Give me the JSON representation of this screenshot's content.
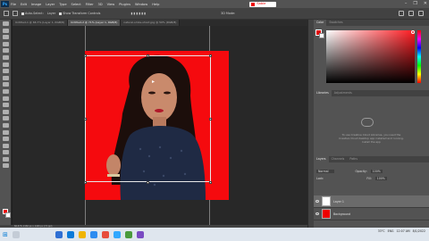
{
  "app": {
    "logo": "Ps",
    "menu": [
      "File",
      "Edit",
      "Image",
      "Layer",
      "Type",
      "Select",
      "Filter",
      "3D",
      "View",
      "Plugins",
      "Window",
      "Help"
    ],
    "search_value": "Sabie",
    "window_controls": [
      "–",
      "❐",
      "✕"
    ]
  },
  "options_bar": {
    "auto_select_label": "Auto-Select:",
    "auto_select_value": "Layer",
    "show_transform": "Show Transform Controls",
    "mode_3d": "3D Mode:"
  },
  "document_tabs": [
    {
      "label": "Untitled-1 @ 66.7% (Layer 1, RGB/8)",
      "active": false
    },
    {
      "label": "Untitled-2 @ 71% (Layer 1, RGB/8)",
      "active": true
    },
    {
      "label": "natural-smile-shoot.jpg @ 50% (RGB/8)",
      "active": false
    }
  ],
  "status_bar": "66.67%   2160 px x 1440 px (72 ppi)",
  "color_panel": {
    "tabs": [
      "Color",
      "Swatches"
    ],
    "foreground": "#e00000",
    "background": "#ffffff"
  },
  "libraries_panel": {
    "tabs": [
      "Libraries",
      "Adjustments"
    ],
    "message": "To use Creative Cloud Libraries, you need the Creative Cloud desktop app installed and running. Install the app"
  },
  "layers_panel": {
    "tabs": [
      "Layers",
      "Channels",
      "Paths"
    ],
    "blend_mode": "Normal",
    "opacity_label": "Opacity:",
    "opacity_value": "100%",
    "fill_label": "Fill:",
    "fill_value": "100%",
    "lock_label": "Lock:",
    "layers": [
      {
        "name": "Layer 1",
        "selected": true
      },
      {
        "name": "Background",
        "selected": false
      }
    ]
  },
  "taskbar": {
    "search_placeholder": "Type here to search",
    "weather": "33°C",
    "language": "ENG",
    "region": "IN",
    "time": "12:07 AM",
    "date": "8/1/2022"
  },
  "colors": {
    "artboard_red": "#f50a0e",
    "accent": "#31a8ff"
  }
}
